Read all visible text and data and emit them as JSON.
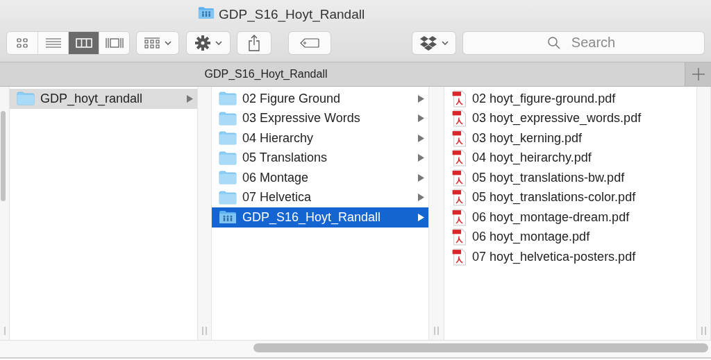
{
  "window": {
    "title": "GDP_S16_Hoyt_Randall"
  },
  "toolbar": {
    "view_modes": [
      {
        "kind": "icons",
        "selected": false
      },
      {
        "kind": "list",
        "selected": false
      },
      {
        "kind": "columns",
        "selected": true
      },
      {
        "kind": "gallery",
        "selected": false
      }
    ],
    "search": {
      "placeholder": "Search"
    }
  },
  "tab_bar": {
    "tabs": [
      {
        "label": "GDP_S16_Hoyt_Randall"
      }
    ]
  },
  "columns": [
    {
      "focused": false,
      "items": [
        {
          "name": "GDP_hoyt_randall",
          "kind": "folder",
          "selected": true
        }
      ]
    },
    {
      "focused": true,
      "items": [
        {
          "name": "02 Figure Ground",
          "kind": "folder",
          "selected": false
        },
        {
          "name": "03 Expressive Words",
          "kind": "folder",
          "selected": false
        },
        {
          "name": "04 Hierarchy",
          "kind": "folder",
          "selected": false
        },
        {
          "name": "05 Translations",
          "kind": "folder",
          "selected": false
        },
        {
          "name": "06 Montage",
          "kind": "folder",
          "selected": false
        },
        {
          "name": "07 Helvetica",
          "kind": "folder",
          "selected": false
        },
        {
          "name": "GDP_S16_Hoyt_Randall",
          "kind": "shared_folder",
          "selected": true
        }
      ]
    },
    {
      "items": [
        {
          "name": "02 hoyt_figure-ground.pdf",
          "kind": "pdf",
          "selected": false
        },
        {
          "name": "03 hoyt_expressive_words.pdf",
          "kind": "pdf",
          "selected": false
        },
        {
          "name": "03 hoyt_kerning.pdf",
          "kind": "pdf",
          "selected": false
        },
        {
          "name": "04 hoyt_heirarchy.pdf",
          "kind": "pdf",
          "selected": false
        },
        {
          "name": "05 hoyt_translations-bw.pdf",
          "kind": "pdf",
          "selected": false
        },
        {
          "name": "05 hoyt_translations-color.pdf",
          "kind": "pdf",
          "selected": false
        },
        {
          "name": "06 hoyt_montage-dream.pdf",
          "kind": "pdf",
          "selected": false
        },
        {
          "name": "06 hoyt_montage.pdf",
          "kind": "pdf",
          "selected": false
        },
        {
          "name": "07 hoyt_helvetica-posters.pdf",
          "kind": "pdf",
          "selected": false
        }
      ]
    }
  ]
}
